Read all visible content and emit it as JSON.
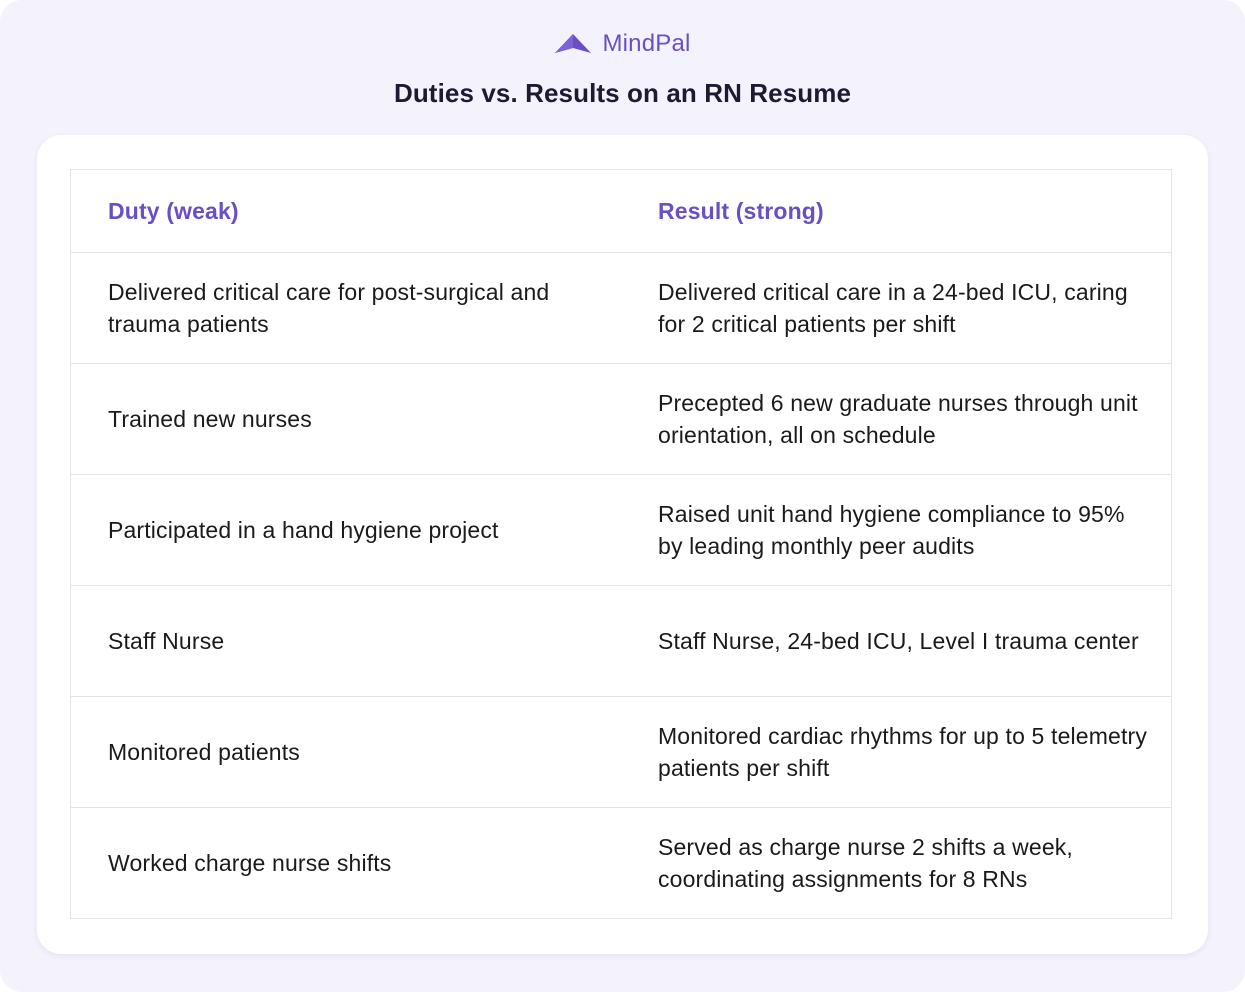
{
  "brand": {
    "name": "MindPal",
    "color": "#6a4fc4",
    "icon": "mindpal-logo-icon"
  },
  "title": "Duties vs. Results on an RN Resume",
  "table": {
    "headers": [
      "Duty (weak)",
      "Result (strong)"
    ],
    "rows": [
      [
        "Delivered critical care for post-surgical and trauma patients",
        "Delivered critical care in a 24-bed ICU, caring for 2 critical patients per shift"
      ],
      [
        "Trained new nurses",
        "Precepted 6 new graduate nurses through unit orientation, all on schedule"
      ],
      [
        "Participated in a hand hygiene project",
        "Raised unit hand hygiene compliance to 95% by leading monthly peer audits"
      ],
      [
        "Staff Nurse",
        "Staff Nurse, 24-bed ICU, Level I trauma center"
      ],
      [
        "Monitored patients",
        "Monitored cardiac rhythms for up to 5 telemetry patients per shift"
      ],
      [
        "Worked charge nurse shifts",
        "Served as charge nurse 2 shifts a week, coordinating assignments for 8 RNs"
      ]
    ]
  },
  "colors": {
    "background": "#f4f2fd",
    "accent": "#6a4fc4",
    "text": "#1a1a1a",
    "border": "#e4e2ea"
  }
}
